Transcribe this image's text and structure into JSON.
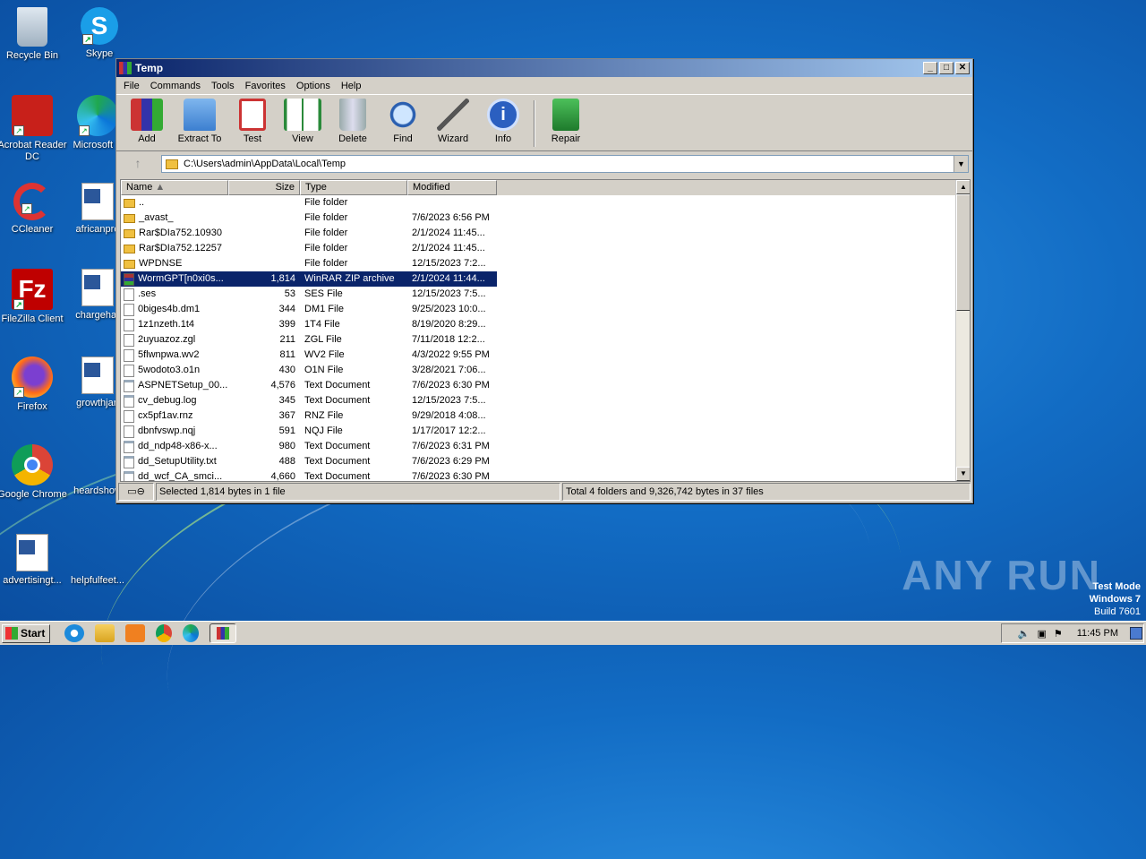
{
  "desktop": {
    "icons": [
      {
        "label": "Recycle Bin"
      },
      {
        "label": "Skype"
      },
      {
        "label": "Acrobat Reader DC"
      },
      {
        "label": "Microsoft E"
      },
      {
        "label": "CCleaner"
      },
      {
        "label": "africanpro"
      },
      {
        "label": "FileZilla Client"
      },
      {
        "label": "chargehar"
      },
      {
        "label": "Firefox"
      },
      {
        "label": "growthjan"
      },
      {
        "label": "Google Chrome"
      },
      {
        "label": "heardshow"
      },
      {
        "label": "advertisingt..."
      },
      {
        "label": "helpfulfeet..."
      }
    ]
  },
  "window": {
    "title": "Temp",
    "menu": [
      "File",
      "Commands",
      "Tools",
      "Favorites",
      "Options",
      "Help"
    ],
    "toolbar": [
      "Add",
      "Extract To",
      "Test",
      "View",
      "Delete",
      "Find",
      "Wizard",
      "Info",
      "Repair"
    ],
    "address": "C:\\Users\\admin\\AppData\\Local\\Temp",
    "columns": [
      "Name",
      "Size",
      "Type",
      "Modified"
    ],
    "rows": [
      {
        "name": "..",
        "size": "",
        "type": "File folder",
        "modified": "",
        "icon": "folder"
      },
      {
        "name": "_avast_",
        "size": "",
        "type": "File folder",
        "modified": "7/6/2023 6:56 PM",
        "icon": "folder"
      },
      {
        "name": "Rar$DIa752.10930",
        "size": "",
        "type": "File folder",
        "modified": "2/1/2024 11:45...",
        "icon": "folder"
      },
      {
        "name": "Rar$DIa752.12257",
        "size": "",
        "type": "File folder",
        "modified": "2/1/2024 11:45...",
        "icon": "folder"
      },
      {
        "name": "WPDNSE",
        "size": "",
        "type": "File folder",
        "modified": "12/15/2023 7:2...",
        "icon": "folder"
      },
      {
        "name": "WormGPT[n0xi0s...",
        "size": "1,814",
        "type": "WinRAR ZIP archive",
        "modified": "2/1/2024 11:44...",
        "icon": "zip",
        "selected": true
      },
      {
        "name": ".ses",
        "size": "53",
        "type": "SES File",
        "modified": "12/15/2023 7:5...",
        "icon": "file"
      },
      {
        "name": "0biges4b.dm1",
        "size": "344",
        "type": "DM1 File",
        "modified": "9/25/2023 10:0...",
        "icon": "file"
      },
      {
        "name": "1z1nzeth.1t4",
        "size": "399",
        "type": "1T4 File",
        "modified": "8/19/2020 8:29...",
        "icon": "file"
      },
      {
        "name": "2uyuazoz.zgl",
        "size": "211",
        "type": "ZGL File",
        "modified": "7/11/2018 12:2...",
        "icon": "file"
      },
      {
        "name": "5flwnpwa.wv2",
        "size": "811",
        "type": "WV2 File",
        "modified": "4/3/2022 9:55 PM",
        "icon": "file"
      },
      {
        "name": "5wodoto3.o1n",
        "size": "430",
        "type": "O1N File",
        "modified": "3/28/2021 7:06...",
        "icon": "file"
      },
      {
        "name": "ASPNETSetup_00...",
        "size": "4,576",
        "type": "Text Document",
        "modified": "7/6/2023 6:30 PM",
        "icon": "txt"
      },
      {
        "name": "cv_debug.log",
        "size": "345",
        "type": "Text Document",
        "modified": "12/15/2023 7:5...",
        "icon": "txt"
      },
      {
        "name": "cx5pf1av.rnz",
        "size": "367",
        "type": "RNZ File",
        "modified": "9/29/2018 4:08...",
        "icon": "file"
      },
      {
        "name": "dbnfvswp.nqj",
        "size": "591",
        "type": "NQJ File",
        "modified": "1/17/2017 12:2...",
        "icon": "file"
      },
      {
        "name": "dd_ndp48-x86-x...",
        "size": "980",
        "type": "Text Document",
        "modified": "7/6/2023 6:31 PM",
        "icon": "txt"
      },
      {
        "name": "dd_SetupUtility.txt",
        "size": "488",
        "type": "Text Document",
        "modified": "7/6/2023 6:29 PM",
        "icon": "txt"
      },
      {
        "name": "dd_wcf_CA_smci...",
        "size": "4,660",
        "type": "Text Document",
        "modified": "7/6/2023 6:30 PM",
        "icon": "txt"
      }
    ],
    "status_left": "Selected 1,814 bytes in 1 file",
    "status_right": "Total 4 folders and 9,326,742 bytes in 37 files"
  },
  "taskbar": {
    "start": "Start",
    "clock": "11:45 PM"
  },
  "watermark": "ANY RUN",
  "testmode": {
    "line1": "Test Mode",
    "line2": "Windows 7",
    "line3": "Build 7601"
  }
}
